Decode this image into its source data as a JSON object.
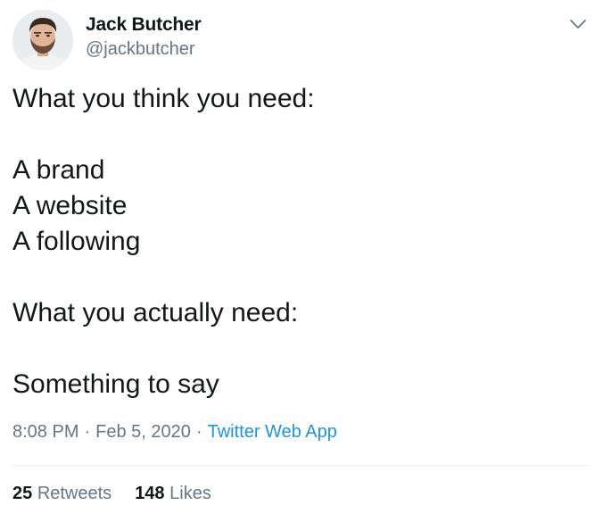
{
  "author": {
    "name": "Jack Butcher",
    "handle": "@jackbutcher"
  },
  "tweet": {
    "lines": [
      "What you think you need:",
      "",
      "A brand",
      "A website",
      "A following",
      "",
      "What you actually need:",
      "",
      "Something to say"
    ],
    "time": "8:08 PM",
    "separator": "·",
    "date": "Feb 5, 2020",
    "source": "Twitter Web App"
  },
  "stats": {
    "retweets_count": "25",
    "retweets_label": "Retweets",
    "likes_count": "148",
    "likes_label": "Likes"
  },
  "icons": {
    "menu": "chevron-down-icon"
  },
  "colors": {
    "text": "#14171a",
    "secondary": "#657786",
    "link": "#1b95e0",
    "divider": "#e6ecf0"
  }
}
